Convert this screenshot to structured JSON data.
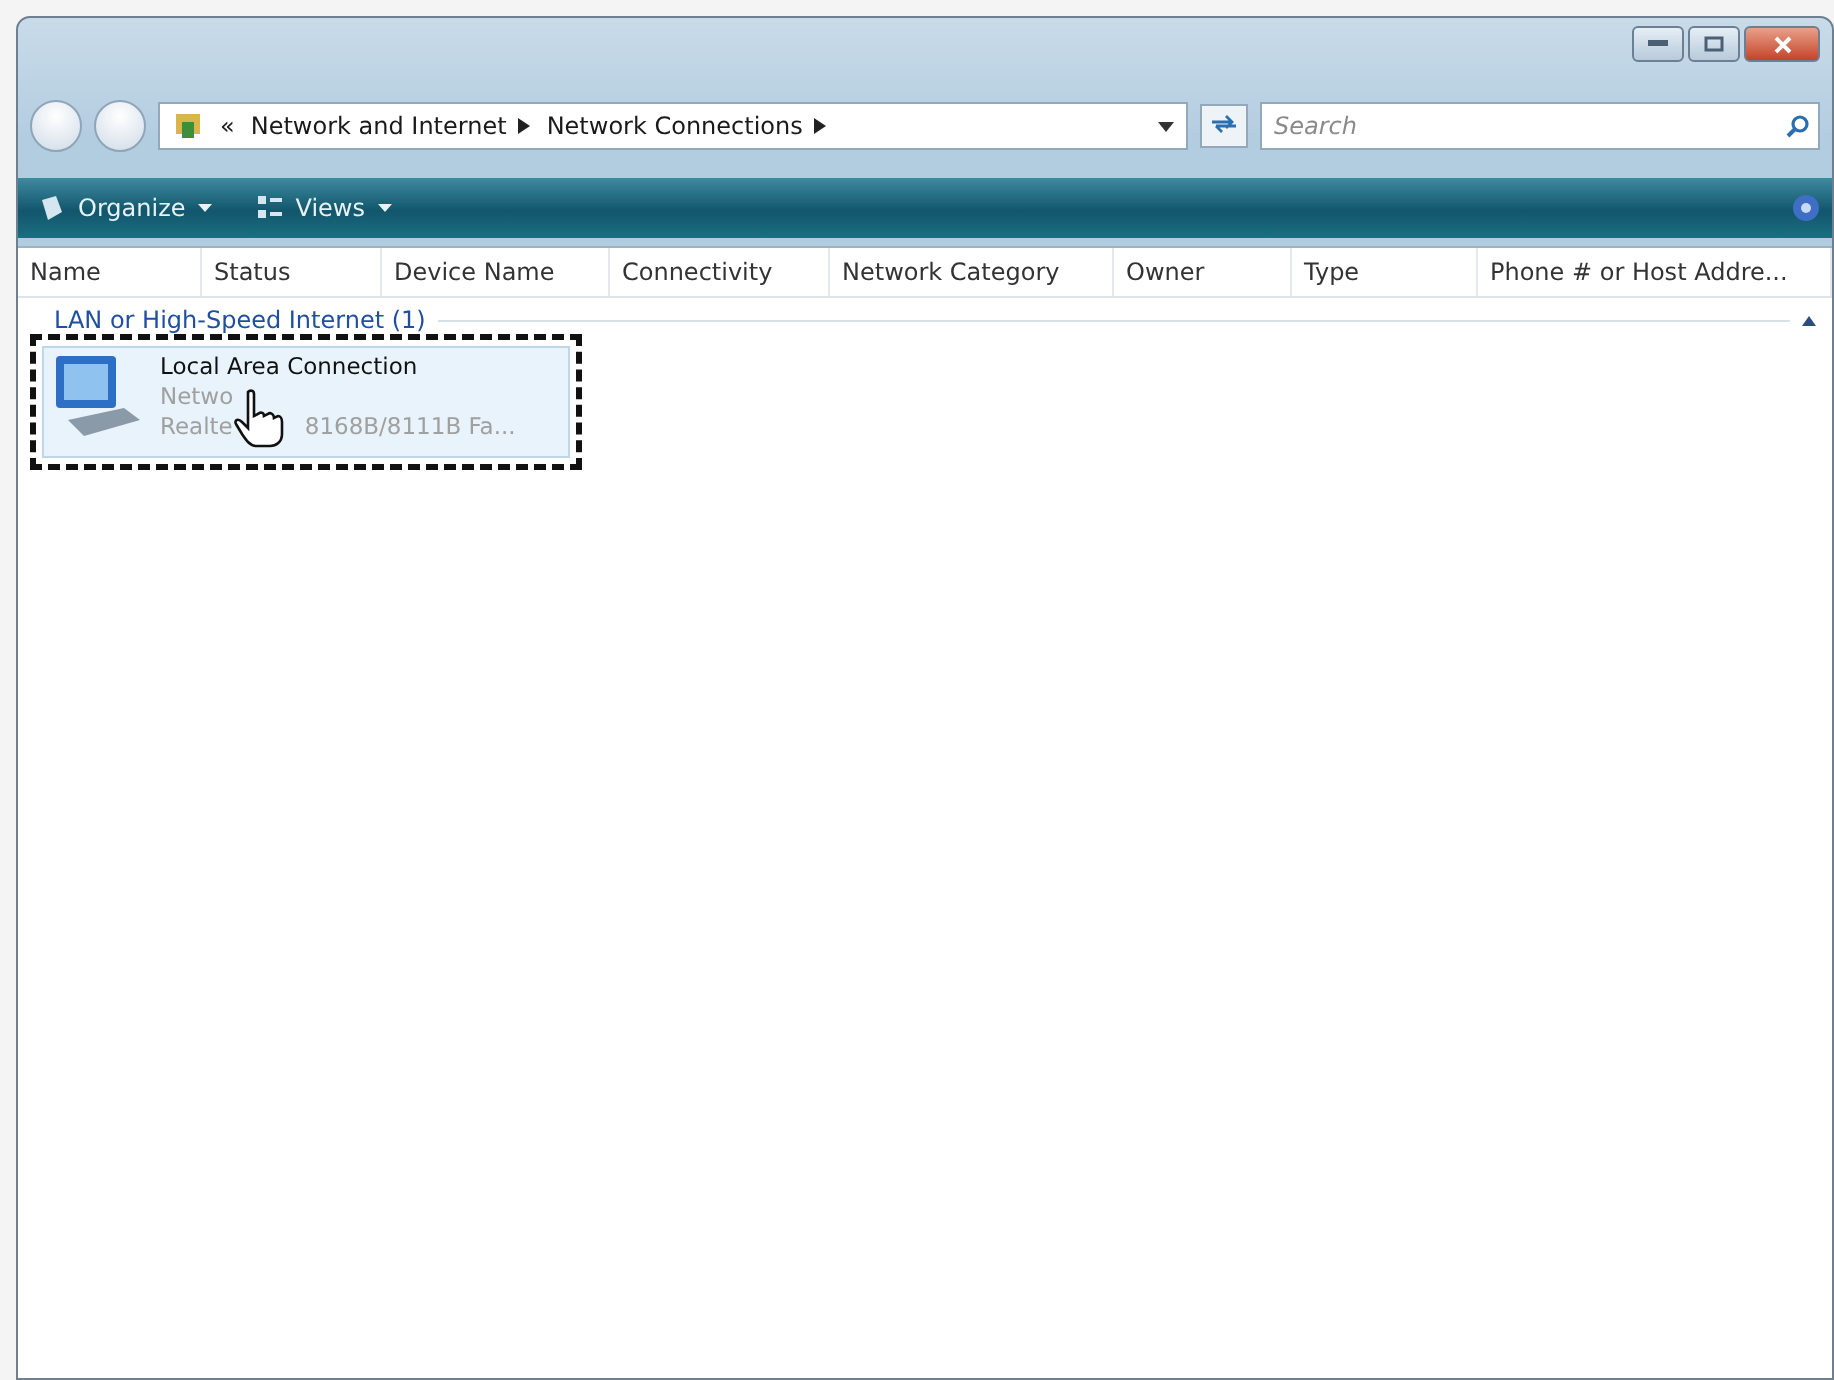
{
  "address": {
    "crumbs": [
      "«",
      "Network and Internet",
      "Network Connections"
    ]
  },
  "search": {
    "placeholder": "Search"
  },
  "toolbar": {
    "buttons": [
      "Organize",
      "Views"
    ]
  },
  "columns": [
    "Name",
    "Status",
    "Device Name",
    "Connectivity",
    "Network Category",
    "Owner",
    "Type",
    "Phone # or Host Addre..."
  ],
  "groups": [
    {
      "title": "LAN or High-Speed Internet (1)",
      "expanded": true,
      "items": [
        {
          "name": "Local Area Connection",
          "status": "Netwo",
          "device": [
            "Realte",
            "8168B/8111B Fa..."
          ],
          "selected": true
        }
      ]
    }
  ]
}
